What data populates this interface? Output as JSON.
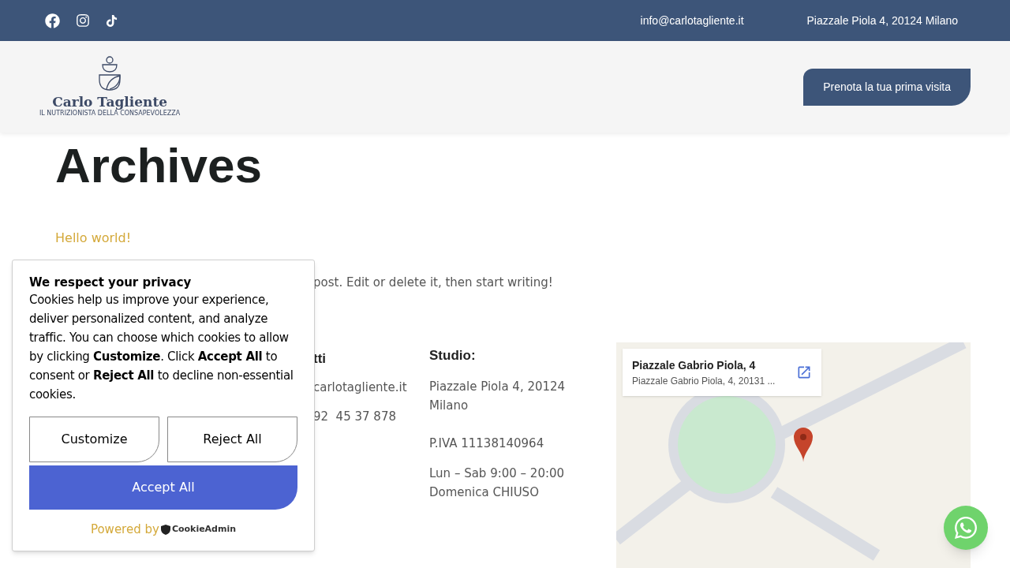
{
  "top_bar": {
    "socials": [
      {
        "kind": "facebook"
      },
      {
        "kind": "instagram"
      },
      {
        "kind": "tiktok"
      }
    ],
    "email": "info@carlotagliente.it",
    "address": "Piazzale Piola 4, 20124 Milano"
  },
  "header": {
    "logo": {
      "name": "Carlo Tagliente",
      "tagline": "IL NUTRIZIONISTA DELLA CONSAPEVOLEZZA"
    },
    "cta": "Prenota la tua prima visita"
  },
  "archive": {
    "title": "Archives",
    "post_title": "Hello world!",
    "excerpt": "post. Edit or delete it, then start writing!"
  },
  "contacts": {
    "heading": "tti",
    "email": "carlotagliente.it",
    "phone": "92  45 37 878"
  },
  "studio": {
    "heading": "Studio:",
    "address": "Piazzale Piola 4, 20124 Milano",
    "vat": "P.IVA 11138140964",
    "hours": [
      "Lun – Sab 9:00 – 20:00",
      "Domenica CHIUSO"
    ]
  },
  "map": {
    "place_title": "Piazzale Gabrio Piola, 4",
    "place_address": "Piazzale Gabrio Piola, 4, 20131 ..."
  },
  "cookie_banner": {
    "title": "We respect your privacy",
    "body": "Cookies help us improve your experience, deliver personalized content, and analyze traffic. You can choose which cookies to allow by clicking **Customize**. Click **Accept All** to consent or **Reject All** to decline non-essential cookies.",
    "buttons": [
      {
        "label": "Customize",
        "kind": "outline"
      },
      {
        "label": "Reject All",
        "kind": "outline"
      },
      {
        "label": "Accept All",
        "kind": "primary"
      }
    ],
    "powered_by": "Powered by",
    "brand": "CookieAdmin"
  }
}
